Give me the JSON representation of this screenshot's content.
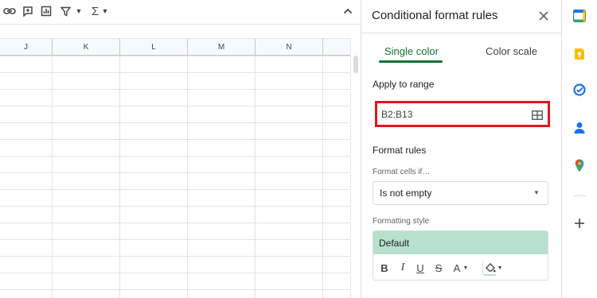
{
  "toolbar": {
    "icons": [
      "link-icon",
      "add-comment-icon",
      "insert-chart-icon",
      "filter-icon",
      "functions-icon",
      "collapse-icon"
    ],
    "functions_symbol": "Σ"
  },
  "sheet": {
    "columns": [
      "J",
      "K",
      "L",
      "M",
      "N"
    ]
  },
  "panel": {
    "title": "Conditional format rules",
    "tabs": [
      {
        "label": "Single color",
        "active": true
      },
      {
        "label": "Color scale",
        "active": false
      }
    ],
    "apply_to_range_label": "Apply to range",
    "range_value": "B2:B13",
    "format_rules_label": "Format rules",
    "format_cells_if_label": "Format cells if…",
    "condition_value": "Is not empty",
    "formatting_style_label": "Formatting style",
    "style_preview_text": "Default",
    "format_buttons": [
      {
        "name": "bold-button",
        "glyph": "B"
      },
      {
        "name": "italic-button",
        "glyph": "I"
      },
      {
        "name": "underline-button",
        "glyph": "U"
      },
      {
        "name": "strikethrough-button",
        "glyph": "S"
      },
      {
        "name": "text-color-button",
        "glyph": "A"
      }
    ],
    "preview_color": "#b7e1cd",
    "highlight_color": "#e0161c",
    "accent_color": "#137333"
  },
  "side_rail": {
    "icons": [
      "calendar-icon",
      "keep-icon",
      "tasks-icon",
      "contacts-icon",
      "maps-icon",
      "add-icon"
    ],
    "calendar_day": "31"
  }
}
